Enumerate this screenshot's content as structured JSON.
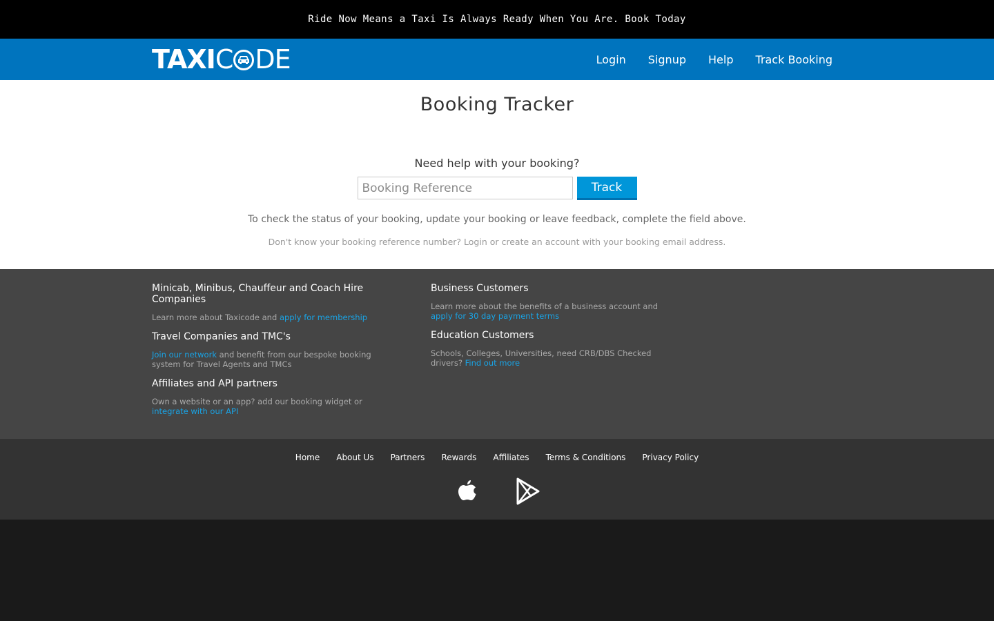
{
  "topbar": {
    "text": "Ride Now Means a Taxi Is Always Ready When You Are. Book Today"
  },
  "header": {
    "logo_left": "TAXI",
    "logo_right": "DE",
    "logo_c": "C",
    "logo_icon": "taxi-car-icon",
    "nav": [
      {
        "label": "Login"
      },
      {
        "label": "Signup"
      },
      {
        "label": "Help"
      },
      {
        "label": "Track Booking"
      }
    ]
  },
  "main": {
    "title": "Booking Tracker",
    "question": "Need help with your booking?",
    "input_placeholder": "Booking Reference",
    "input_value": "",
    "track_button": "Track",
    "note1": "To check the status of your booking, update your booking or leave feedback, complete the field above.",
    "note2": "Don't know your booking reference number? Login or create an account with your booking email address."
  },
  "footer": {
    "col1": [
      {
        "title": "Minicab, Minibus, Chauffeur and Coach Hire Companies",
        "pre": "Learn more about Taxicode and ",
        "link": "apply for membership",
        "post": ""
      },
      {
        "title": "Travel Companies and TMC's",
        "pre": "",
        "link": "Join our network",
        "post": " and benefit from our bespoke booking system for Travel Agents and TMCs"
      },
      {
        "title": "Affiliates and API partners",
        "pre": "Own a website or an app? add our booking widget or ",
        "link": "integrate with our API",
        "post": ""
      }
    ],
    "col2": [
      {
        "title": "Business Customers",
        "pre": "Learn more about the benefits of a business account and ",
        "link": "apply for 30 day payment terms",
        "post": ""
      },
      {
        "title": "Education Customers",
        "pre": "Schools, Colleges, Universities, need CRB/DBS Checked drivers? ",
        "link": "Find out more",
        "post": ""
      }
    ],
    "links": [
      {
        "label": "Home"
      },
      {
        "label": "About Us"
      },
      {
        "label": "Partners"
      },
      {
        "label": "Rewards"
      },
      {
        "label": "Affiliates"
      },
      {
        "label": "Terms & Conditions"
      },
      {
        "label": "Privacy Policy"
      }
    ],
    "apps": [
      "apple-icon",
      "google-play-icon"
    ]
  },
  "colors": {
    "header_blue": "#0074be",
    "button_blue": "#0096d9",
    "link_blue": "#19a4e6",
    "footer_top": "#454545",
    "footer_bottom": "#333333"
  }
}
